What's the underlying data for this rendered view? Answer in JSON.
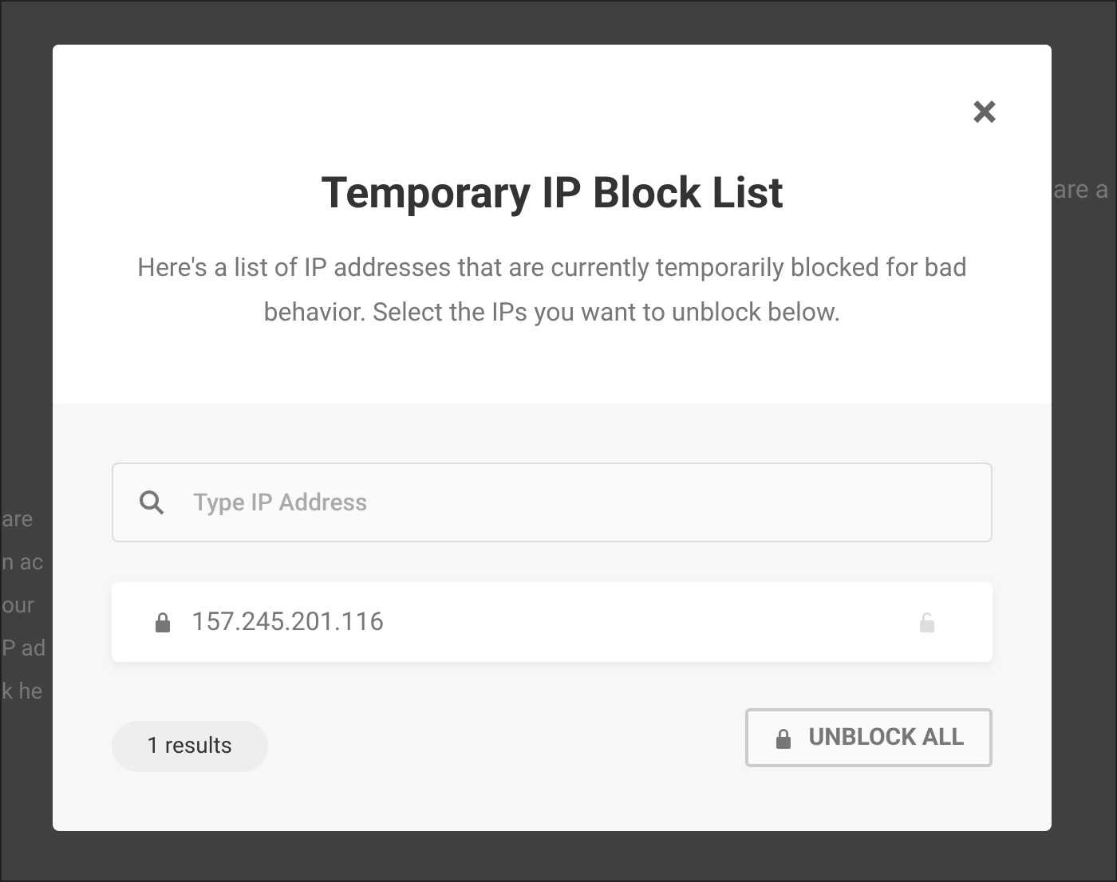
{
  "background": {
    "right_fragments": [
      "are a"
    ],
    "left_fragments": [
      "are",
      "n ac",
      "our",
      "P ad",
      "k he"
    ]
  },
  "modal": {
    "close": "×",
    "title": "Temporary IP Block List",
    "description": "Here's a list of IP addresses that are currently temporarily blocked for bad behavior. Select the IPs you want to unblock below.",
    "search": {
      "placeholder": "Type IP Address"
    },
    "blocked_ips": [
      {
        "address": "157.245.201.116"
      }
    ],
    "results": "1 results",
    "unblock_all": "UNBLOCK ALL"
  }
}
